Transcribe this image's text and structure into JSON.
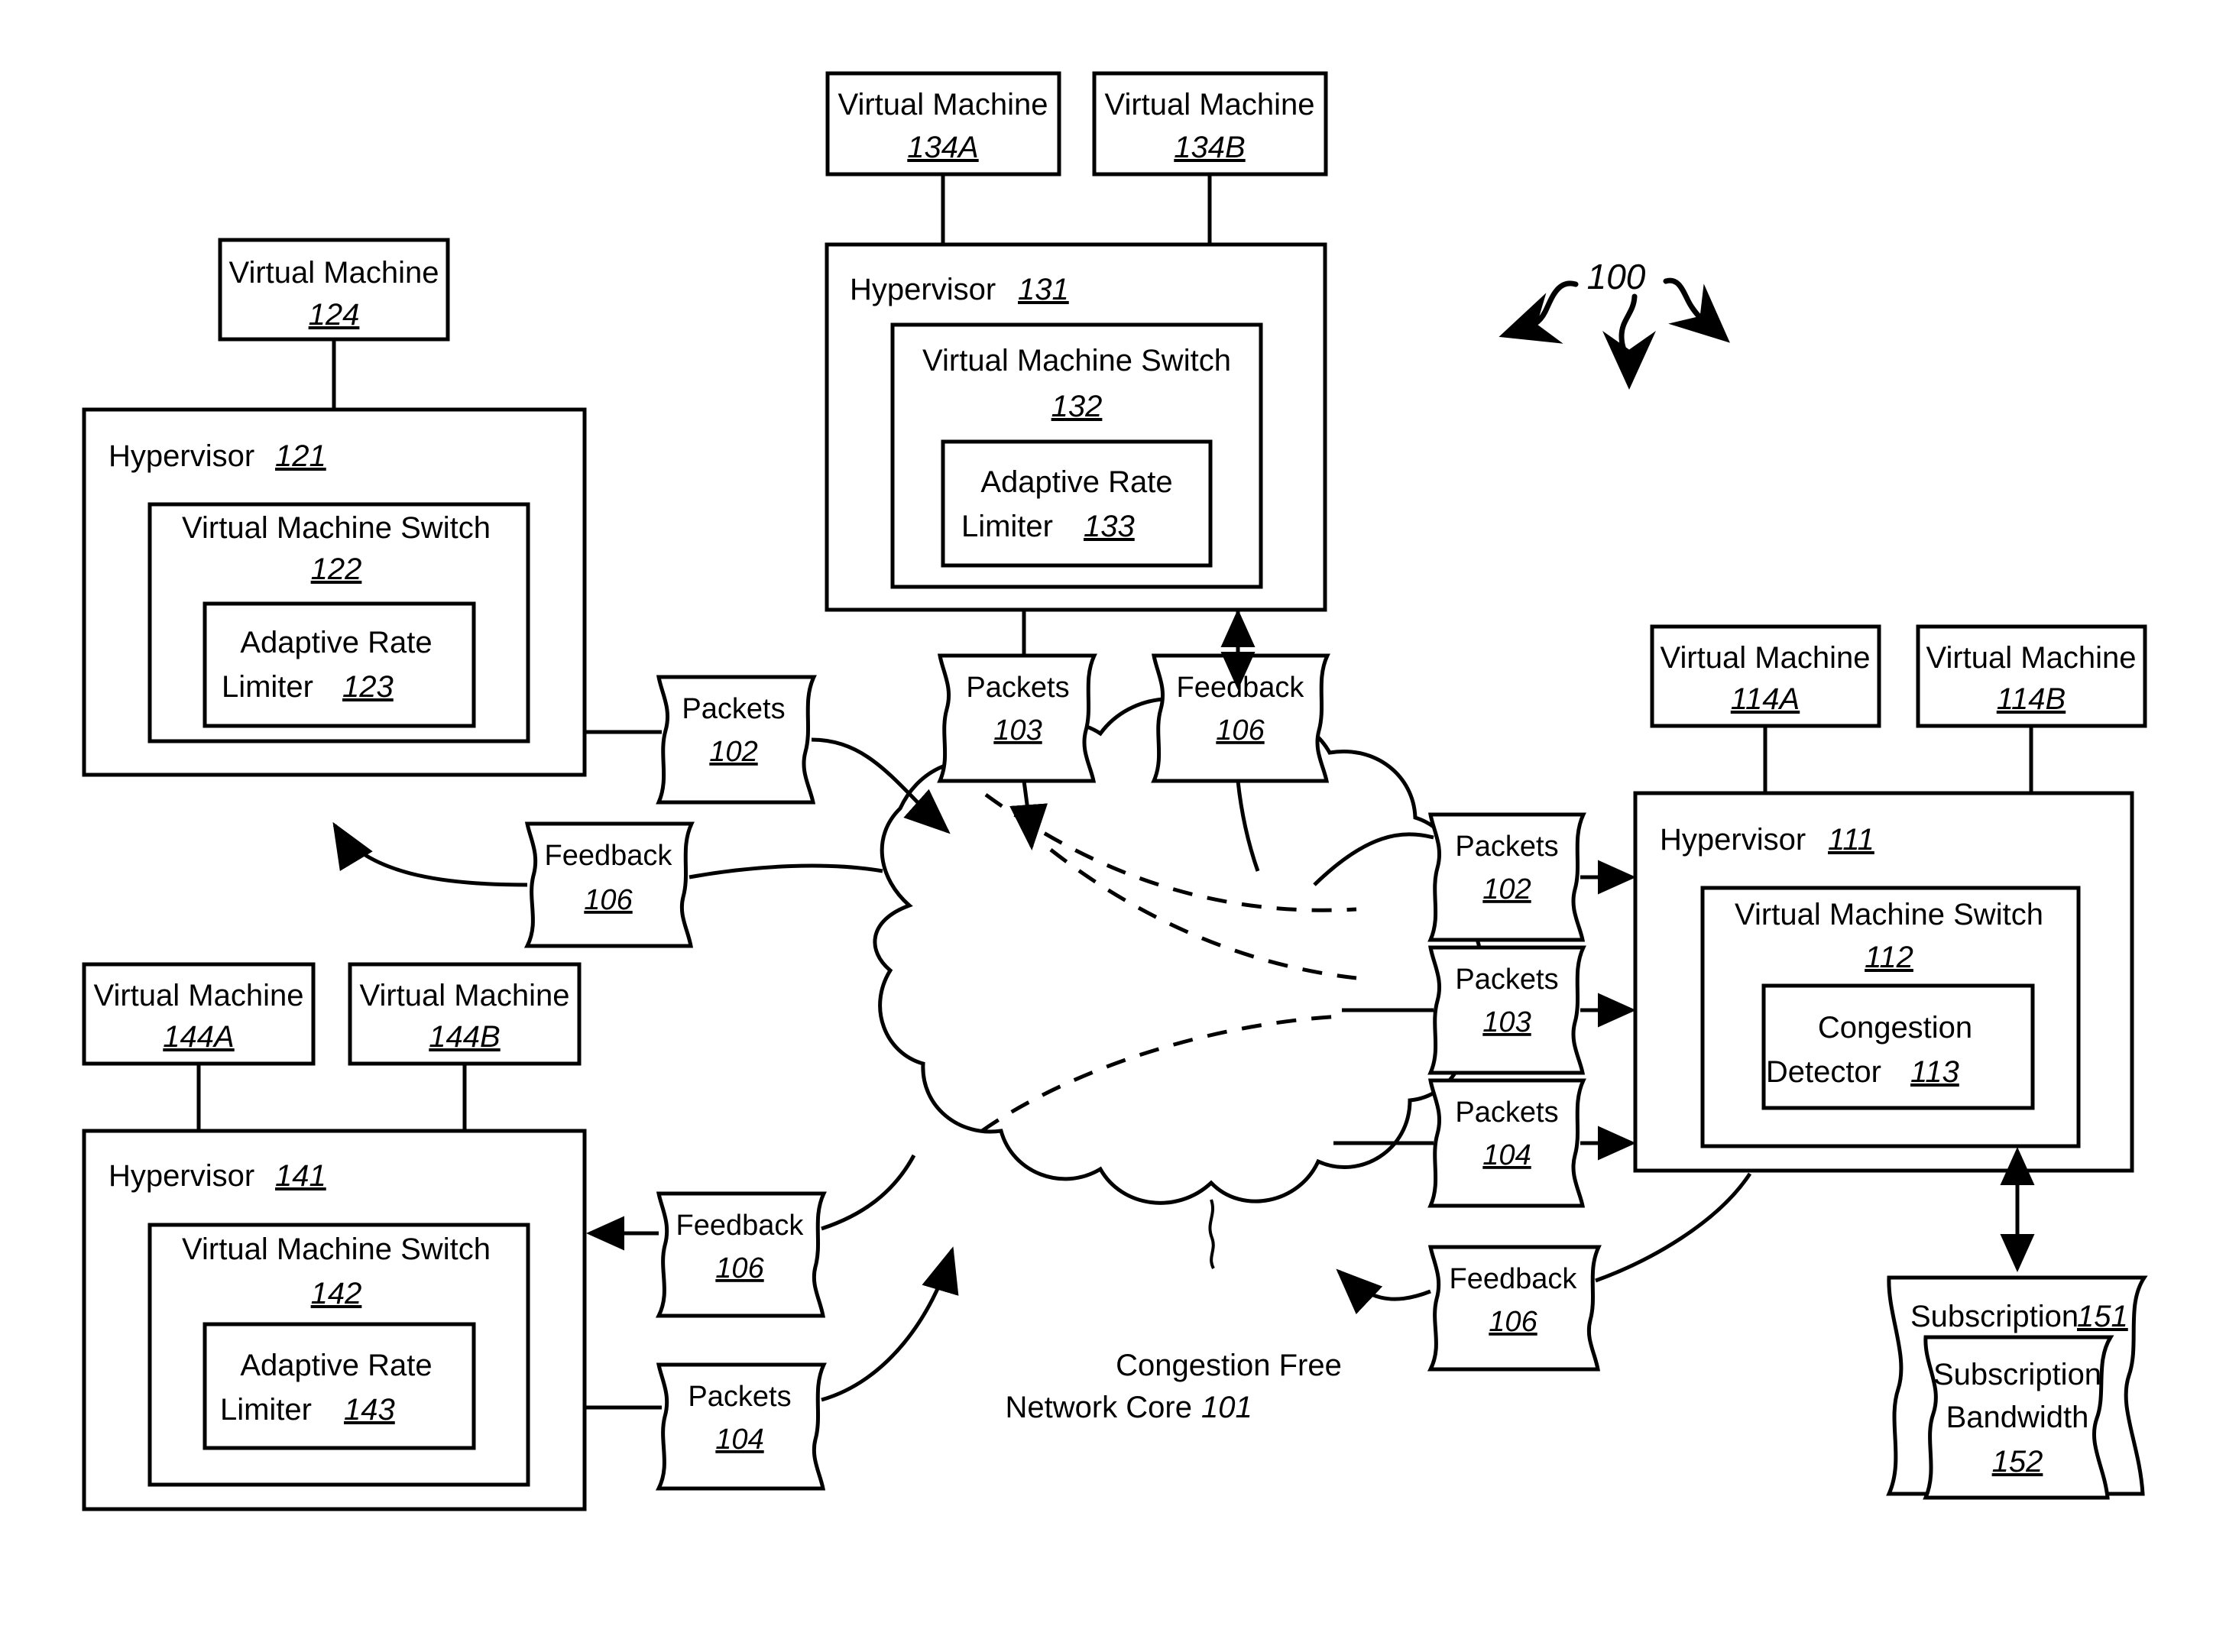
{
  "figure": {
    "reference_number": "100",
    "cloud": {
      "label_line1": "Congestion Free",
      "label_line2": "Network Core",
      "label_ref": "101"
    }
  },
  "nodes": {
    "vm124": {
      "title": "Virtual Machine",
      "ref": "124"
    },
    "hv121": {
      "title": "Hypervisor",
      "ref": "121",
      "switch": {
        "title": "Virtual Machine Switch",
        "ref": "122",
        "inner": {
          "line1": "Adaptive Rate",
          "line2": "Limiter",
          "ref": "123"
        }
      }
    },
    "vm134a": {
      "title": "Virtual Machine",
      "ref": "134A"
    },
    "vm134b": {
      "title": "Virtual Machine",
      "ref": "134B"
    },
    "hv131": {
      "title": "Hypervisor",
      "ref": "131",
      "switch": {
        "title": "Virtual Machine Switch",
        "ref": "132",
        "inner": {
          "line1": "Adaptive Rate",
          "line2": "Limiter",
          "ref": "133"
        }
      }
    },
    "vm114a": {
      "title": "Virtual Machine",
      "ref": "114A"
    },
    "vm114b": {
      "title": "Virtual Machine",
      "ref": "114B"
    },
    "hv111": {
      "title": "Hypervisor",
      "ref": "111",
      "switch": {
        "title": "Virtual Machine Switch",
        "ref": "112",
        "inner": {
          "line1": "Congestion",
          "line2": "Detector",
          "ref": "113"
        }
      }
    },
    "vm144a": {
      "title": "Virtual Machine",
      "ref": "144A"
    },
    "vm144b": {
      "title": "Virtual Machine",
      "ref": "144B"
    },
    "hv141": {
      "title": "Hypervisor",
      "ref": "141",
      "switch": {
        "title": "Virtual Machine Switch",
        "ref": "142",
        "inner": {
          "line1": "Adaptive Rate",
          "line2": "Limiter",
          "ref": "143"
        }
      }
    },
    "subscription": {
      "title": "Subscription",
      "ref": "151",
      "inner": {
        "line1": "Subscription",
        "line2": "Bandwidth",
        "ref": "152"
      }
    }
  },
  "flags": [
    {
      "id": "packets-102-left",
      "label": "Packets",
      "ref": "102"
    },
    {
      "id": "feedback-106-left",
      "label": "Feedback",
      "ref": "106"
    },
    {
      "id": "packets-103-top",
      "label": "Packets",
      "ref": "103"
    },
    {
      "id": "feedback-106-top",
      "label": "Feedback",
      "ref": "106"
    },
    {
      "id": "packets-102-right",
      "label": "Packets",
      "ref": "102"
    },
    {
      "id": "packets-103-right",
      "label": "Packets",
      "ref": "103"
    },
    {
      "id": "packets-104-right",
      "label": "Packets",
      "ref": "104"
    },
    {
      "id": "feedback-106-bottomleft",
      "label": "Feedback",
      "ref": "106"
    },
    {
      "id": "packets-104-bottomleft",
      "label": "Packets",
      "ref": "104"
    },
    {
      "id": "feedback-106-bottomright",
      "label": "Feedback",
      "ref": "106"
    }
  ],
  "colors": {
    "stroke": "#000000",
    "background": "#ffffff"
  }
}
